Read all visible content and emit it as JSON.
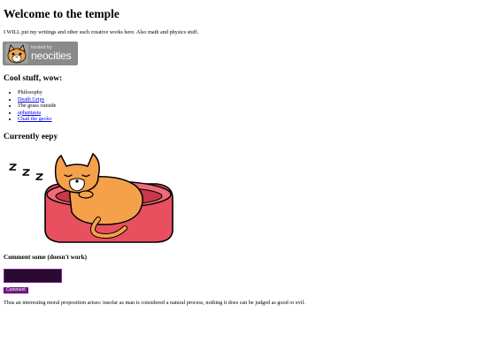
{
  "header": {
    "title": "Welcome to the temple"
  },
  "intro": "I WILL put my writings and other such creative works here. Also math and physics stuff.",
  "badge": {
    "hosted_by": "hosted by",
    "brand": "neocities",
    "bg_color": "#8a8a8a"
  },
  "cool_section": {
    "heading": "Cool stuff, wow:",
    "items": [
      {
        "label": "Philosophy",
        "is_link": false
      },
      {
        "label": "Death Grips",
        "is_link": true
      },
      {
        "label": "The grass outside",
        "is_link": false
      },
      {
        "label": "aphantasia",
        "is_link": true
      },
      {
        "label": "Chad the gecko",
        "is_link": true
      }
    ]
  },
  "status_section": {
    "heading": "Currently eepy",
    "image": "sleeping-cat-in-bed-illustration"
  },
  "comment_section": {
    "heading": "Comment some (doesn't work)",
    "input_value": "",
    "submit_label": "Comment",
    "accent_color": "#7a1a8a"
  },
  "footer_quote": "Thus an interesting moral proposition arises: insofar as man is considered a natural process, nothing it does can be judged as good or evil."
}
